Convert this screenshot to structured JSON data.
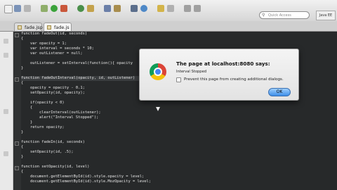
{
  "toolbar": {
    "quick_access_placeholder": "Quick Access",
    "perspective_label": "Java EE"
  },
  "tabs": [
    {
      "label": "fade.jsp"
    },
    {
      "label": "fade.js"
    }
  ],
  "code_lines": [
    "function fadeOut(id, seconds)",
    "{",
    "    var opacity = 1;",
    "    var interval = seconds * 10;",
    "    var outListener = null;",
    "",
    "    outListener = setInterval(function(){ opacity",
    "}",
    "",
    "function fadeOutInterval(opacity, id, outListener)",
    "{",
    "    opacity = opacity - 0.1;",
    "    setOpacity(id, opacity);",
    "",
    "    if(opacity < 0)",
    "    {",
    "        clearInterval(outListener);",
    "        alert(\"Interval Stopped\");",
    "    }",
    "    return opacity;",
    "}",
    "",
    "function fadeIn(id, seconds)",
    "{",
    "    setOpacity(id, .5);",
    "}",
    "",
    "function setOpacity(id, level)",
    "{",
    "    document.getElementById(id).style.opacity = level;",
    "    document.getElementById(id).style.MozOpacity = level;"
  ],
  "dialog": {
    "title": "The page at localhost:8080 says:",
    "message": "Interval Stopped",
    "checkbox_label": "Prevent this page from creating additional dialogs.",
    "ok_label": "OK"
  }
}
